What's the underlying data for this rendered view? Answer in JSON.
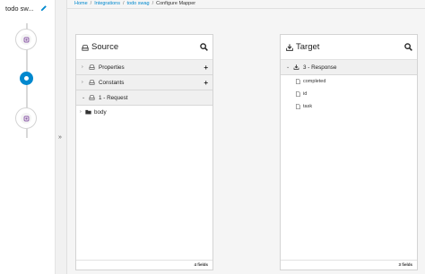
{
  "sidebar": {
    "flow_title": "todo sw...",
    "steps": [
      "start-step",
      "active-step",
      "end-step"
    ]
  },
  "breadcrumb": {
    "items": [
      "Home",
      "Integrations",
      "todo swag"
    ],
    "current": "Configure Mapper"
  },
  "source": {
    "title": "Source",
    "rows": [
      {
        "label": "Properties",
        "action": "+"
      },
      {
        "label": "Constants",
        "action": "+"
      },
      {
        "label": "1 - Request"
      }
    ],
    "child": "body",
    "footer": "4 fields"
  },
  "target": {
    "title": "Target",
    "section": "3 - Response",
    "fields": [
      "completed",
      "id",
      "task"
    ],
    "footer": "3 fields"
  },
  "colors": {
    "accent": "#0088ce",
    "background": "#f5f5f5"
  }
}
